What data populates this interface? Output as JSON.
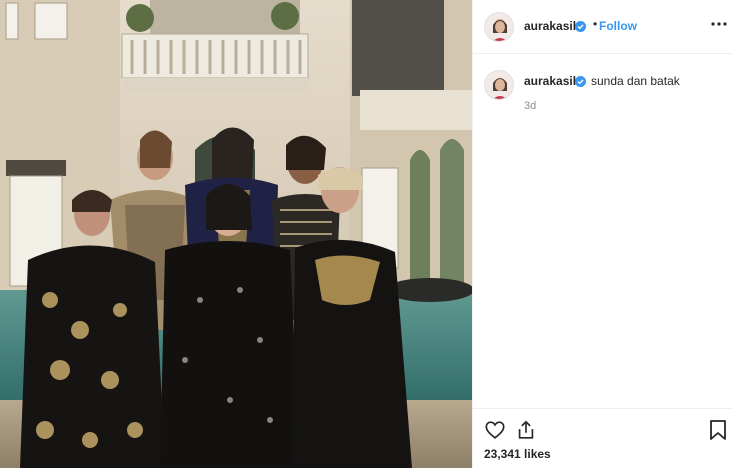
{
  "post": {
    "author": {
      "username": "aurakasih",
      "verified": true,
      "avatar_icon": "profile-avatar-icon"
    },
    "header": {
      "separator": "•",
      "follow_label": "Follow",
      "more_icon": "more-options-icon"
    },
    "caption": {
      "username": "aurakasih",
      "text": "sunda dan batak",
      "time": "3d"
    },
    "actions": {
      "like_icon": "heart-icon",
      "share_icon": "share-icon",
      "save_icon": "bookmark-icon",
      "likes_text": "23,341 likes"
    },
    "colors": {
      "link_blue": "#3897f0",
      "verified_blue": "#3897f0",
      "muted_text": "#8e8e8e",
      "border": "#efefef"
    }
  }
}
